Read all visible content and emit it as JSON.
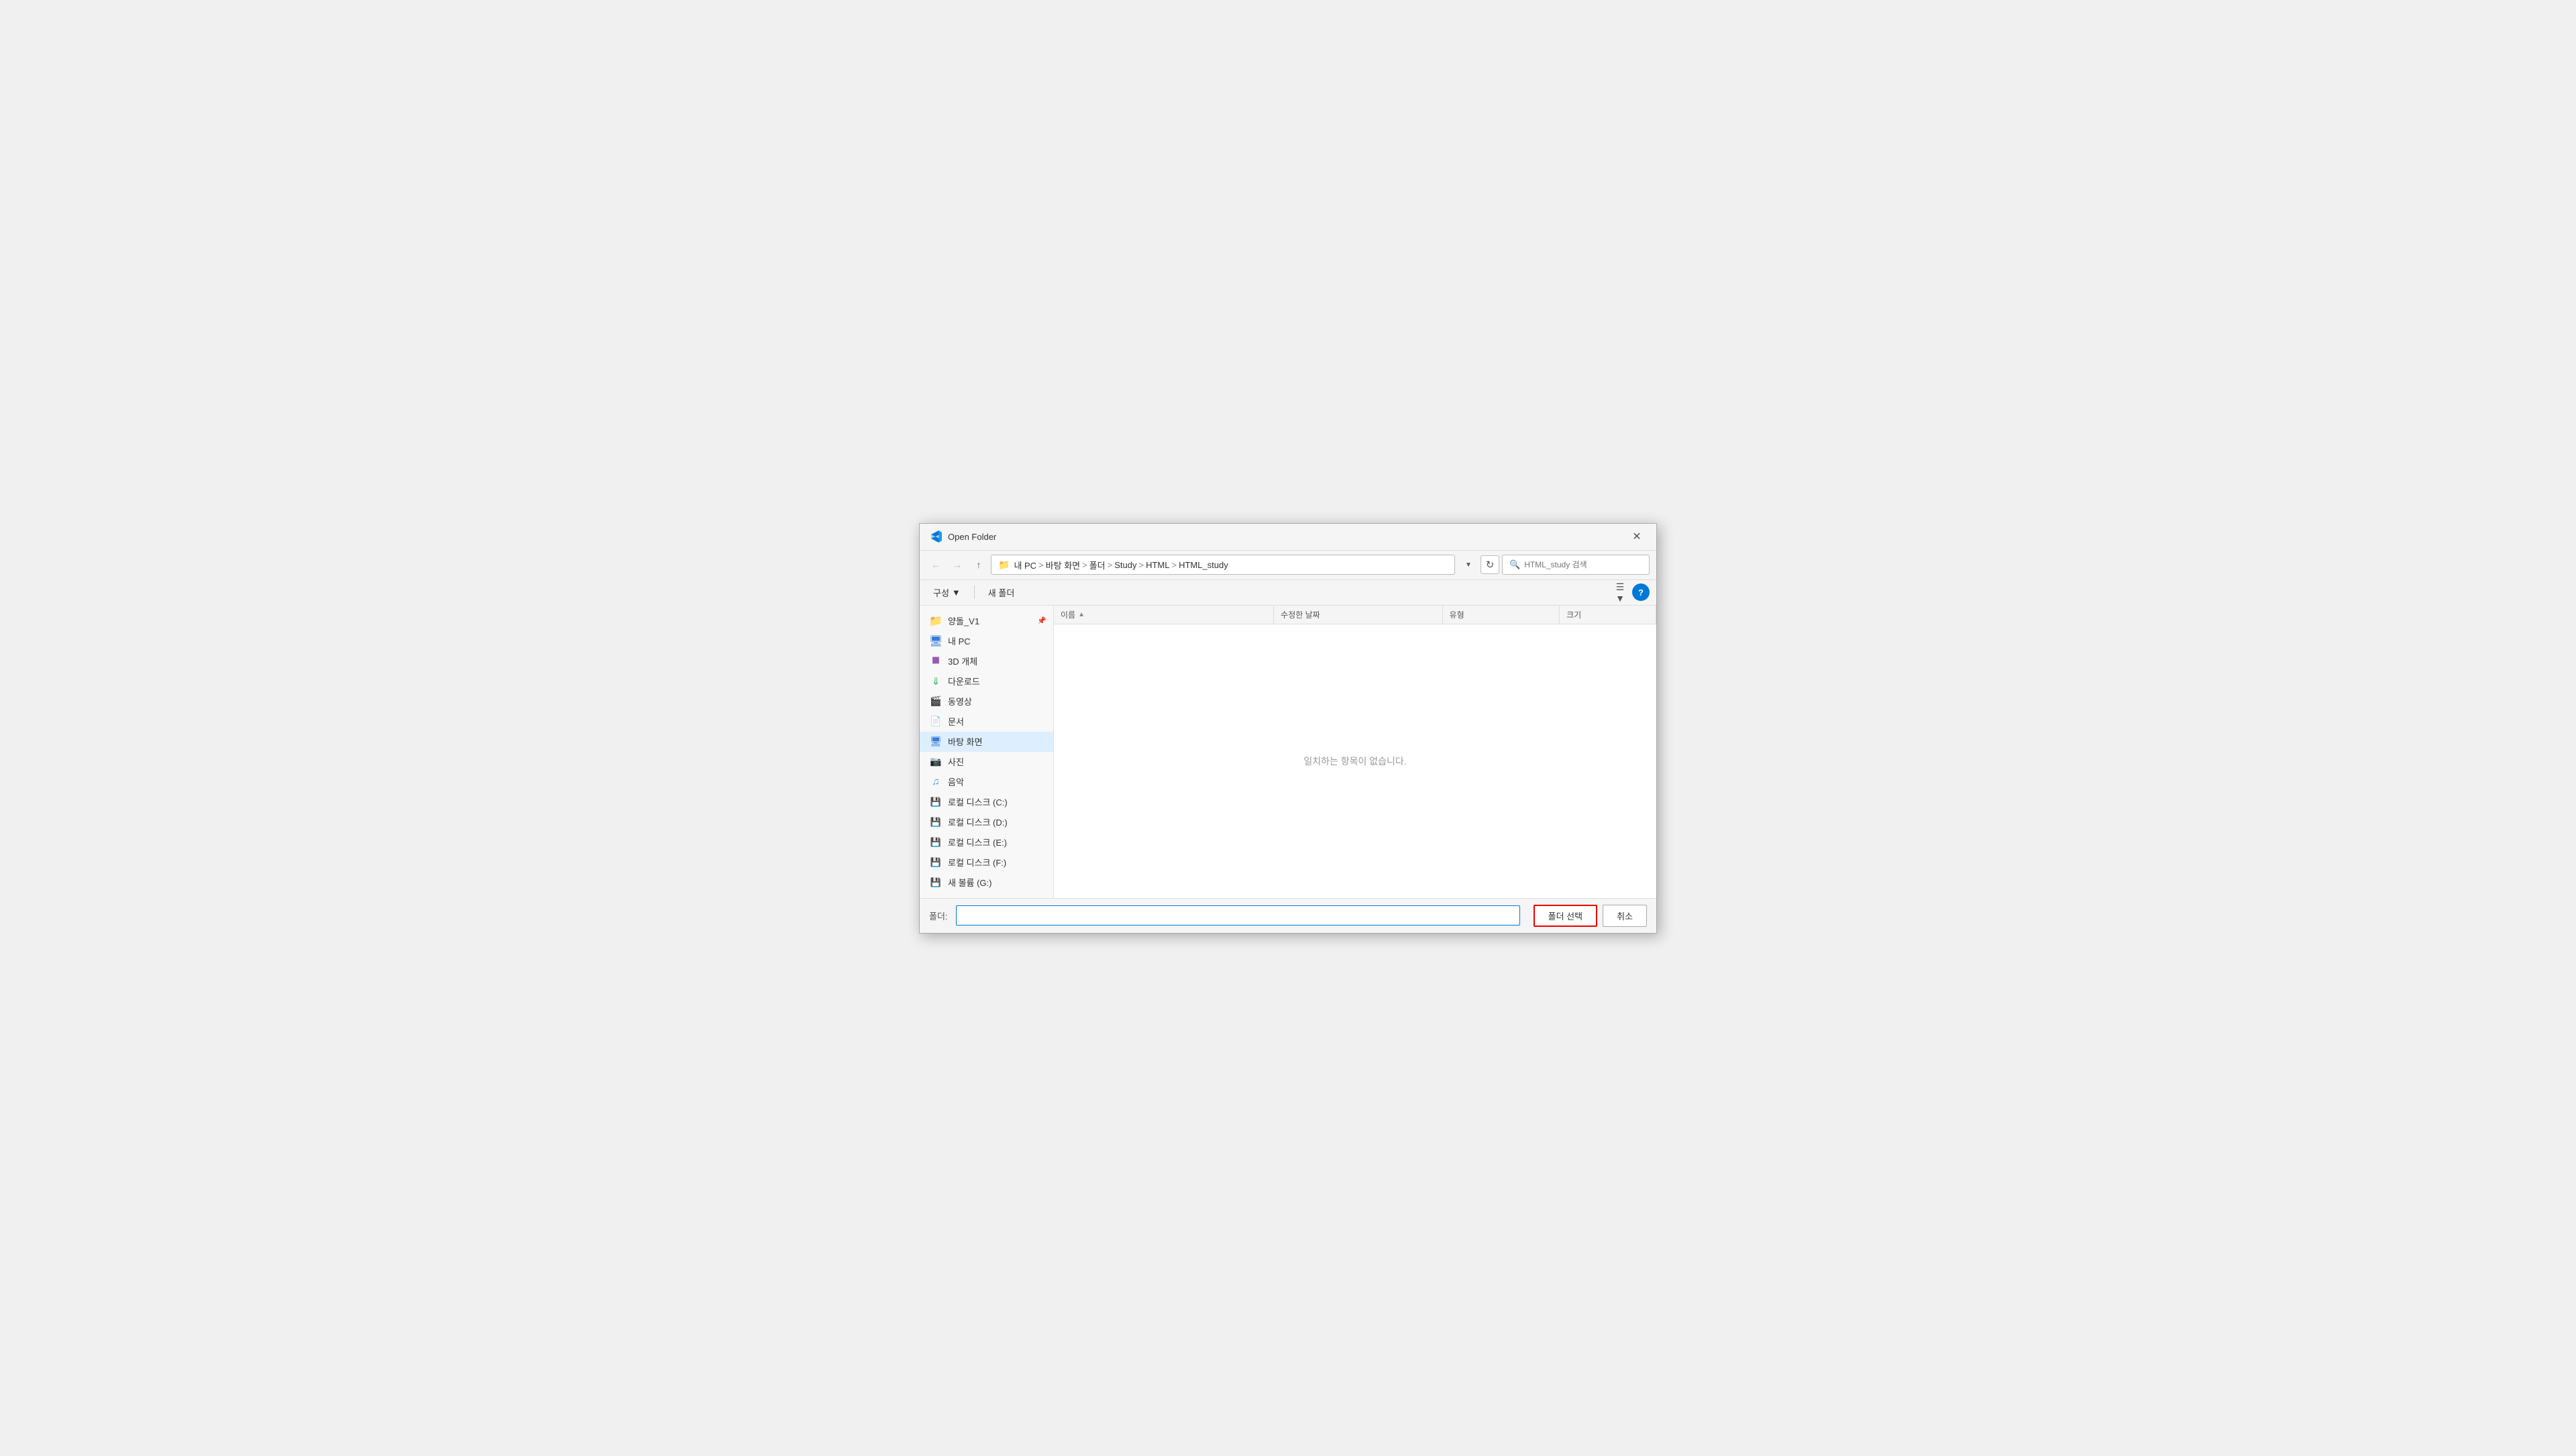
{
  "dialog": {
    "title": "Open Folder",
    "close_label": "✕"
  },
  "address": {
    "path_parts": [
      "내 PC",
      "바탕 화면",
      "폴더",
      "Study",
      "HTML",
      "HTML_study"
    ],
    "search_placeholder": "HTML_study 검색"
  },
  "toolbar": {
    "config_label": "구성",
    "new_folder_label": "새 폴더"
  },
  "sidebar": {
    "items": [
      {
        "id": "yangtul",
        "label": "양돌_V1",
        "type": "folder",
        "pinned": true
      },
      {
        "id": "my-pc",
        "label": "내 PC",
        "type": "pc"
      },
      {
        "id": "3d",
        "label": "3D 개체",
        "type": "3d"
      },
      {
        "id": "download",
        "label": "다운로드",
        "type": "download"
      },
      {
        "id": "video",
        "label": "동영상",
        "type": "video"
      },
      {
        "id": "doc",
        "label": "문서",
        "type": "doc"
      },
      {
        "id": "desktop",
        "label": "바탕 화면",
        "type": "desktop",
        "active": true
      },
      {
        "id": "photo",
        "label": "사진",
        "type": "photo"
      },
      {
        "id": "music",
        "label": "음악",
        "type": "music"
      },
      {
        "id": "local-c",
        "label": "로컬 디스크 (C:)",
        "type": "drive"
      },
      {
        "id": "local-d",
        "label": "로컬 디스크 (D:)",
        "type": "drive"
      },
      {
        "id": "local-e",
        "label": "로컬 디스크 (E:)",
        "type": "drive"
      },
      {
        "id": "local-f",
        "label": "로컬 디스크 (F:)",
        "type": "drive"
      },
      {
        "id": "new-vol",
        "label": "새 볼륨 (G:)",
        "type": "drive"
      }
    ]
  },
  "file_list": {
    "columns": {
      "name": "이름",
      "date": "수정한 날짜",
      "type": "유형",
      "size": "크기"
    },
    "empty_message": "일치하는 항목이 없습니다."
  },
  "bottom": {
    "folder_label": "폴더:",
    "folder_value": "",
    "select_button": "폴더 선택",
    "cancel_button": "취소"
  }
}
